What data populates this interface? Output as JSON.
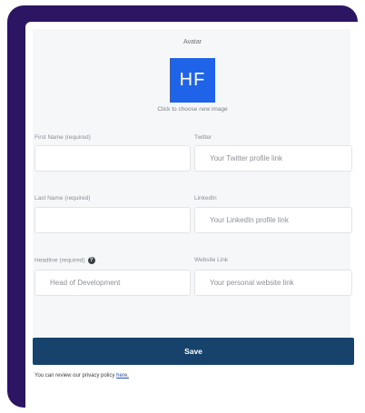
{
  "avatar": {
    "label": "Avatar",
    "initials": "HF",
    "hint": "Click to choose new image"
  },
  "fields": {
    "first_name": {
      "label": "First Name (required)",
      "value": "",
      "placeholder": ""
    },
    "twitter": {
      "label": "Twitter",
      "value": "",
      "placeholder": "Your Twitter profile link"
    },
    "last_name": {
      "label": "Last Name (required)",
      "value": "",
      "placeholder": ""
    },
    "linkedin": {
      "label": "LinkedIn",
      "value": "",
      "placeholder": "Your LinkedIn profile link"
    },
    "headline": {
      "label": "Headline (required)",
      "value": "",
      "placeholder": "Head of Development",
      "help_icon": "question-circle-icon"
    },
    "website": {
      "label": "Website Link",
      "value": "",
      "placeholder": "Your personal website link"
    }
  },
  "save_label": "Save",
  "privacy": {
    "text": "You can review our privacy policy ",
    "link": "here."
  },
  "colors": {
    "frame": "#2c1563",
    "avatar_bg": "#1f63e8",
    "save_button": "#16426c"
  }
}
